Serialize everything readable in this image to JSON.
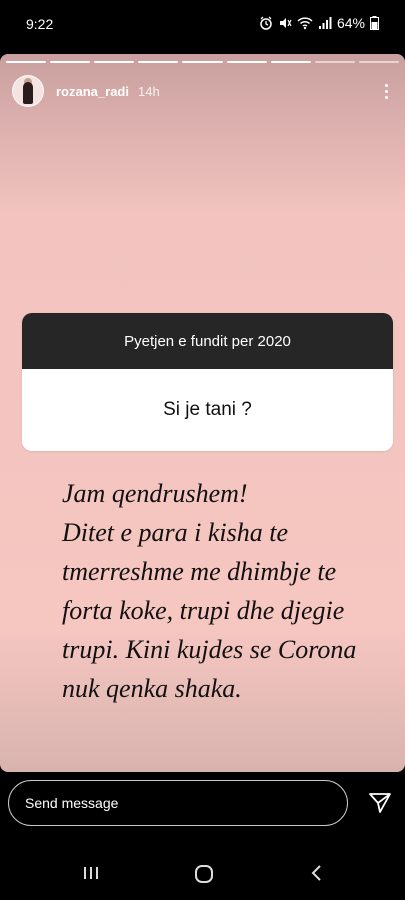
{
  "status_bar": {
    "time": "9:22",
    "battery": "64%",
    "icons": [
      "alarm-icon",
      "mute-icon",
      "wifi-icon",
      "signal-icon",
      "battery-icon"
    ]
  },
  "story": {
    "segments_total": 9,
    "segments_viewed": 7,
    "username": "rozana_radi",
    "time_ago": "14h",
    "question_box": {
      "prompt": "Pyetjen e fundit per 2020",
      "question": "Si je tani ?"
    },
    "answer_lines": [
      "Jam qendrushem!",
      "Ditet e para i kisha te",
      "tmerreshme me dhimbje te",
      "forta koke, trupi dhe djegie",
      "trupi. Kini kujdes se Corona",
      "nuk qenka shaka."
    ]
  },
  "reply": {
    "placeholder": "Send message"
  },
  "colors": {
    "story_bg": "#f6c6c1",
    "question_header": "#262626",
    "question_body": "#ffffff"
  }
}
